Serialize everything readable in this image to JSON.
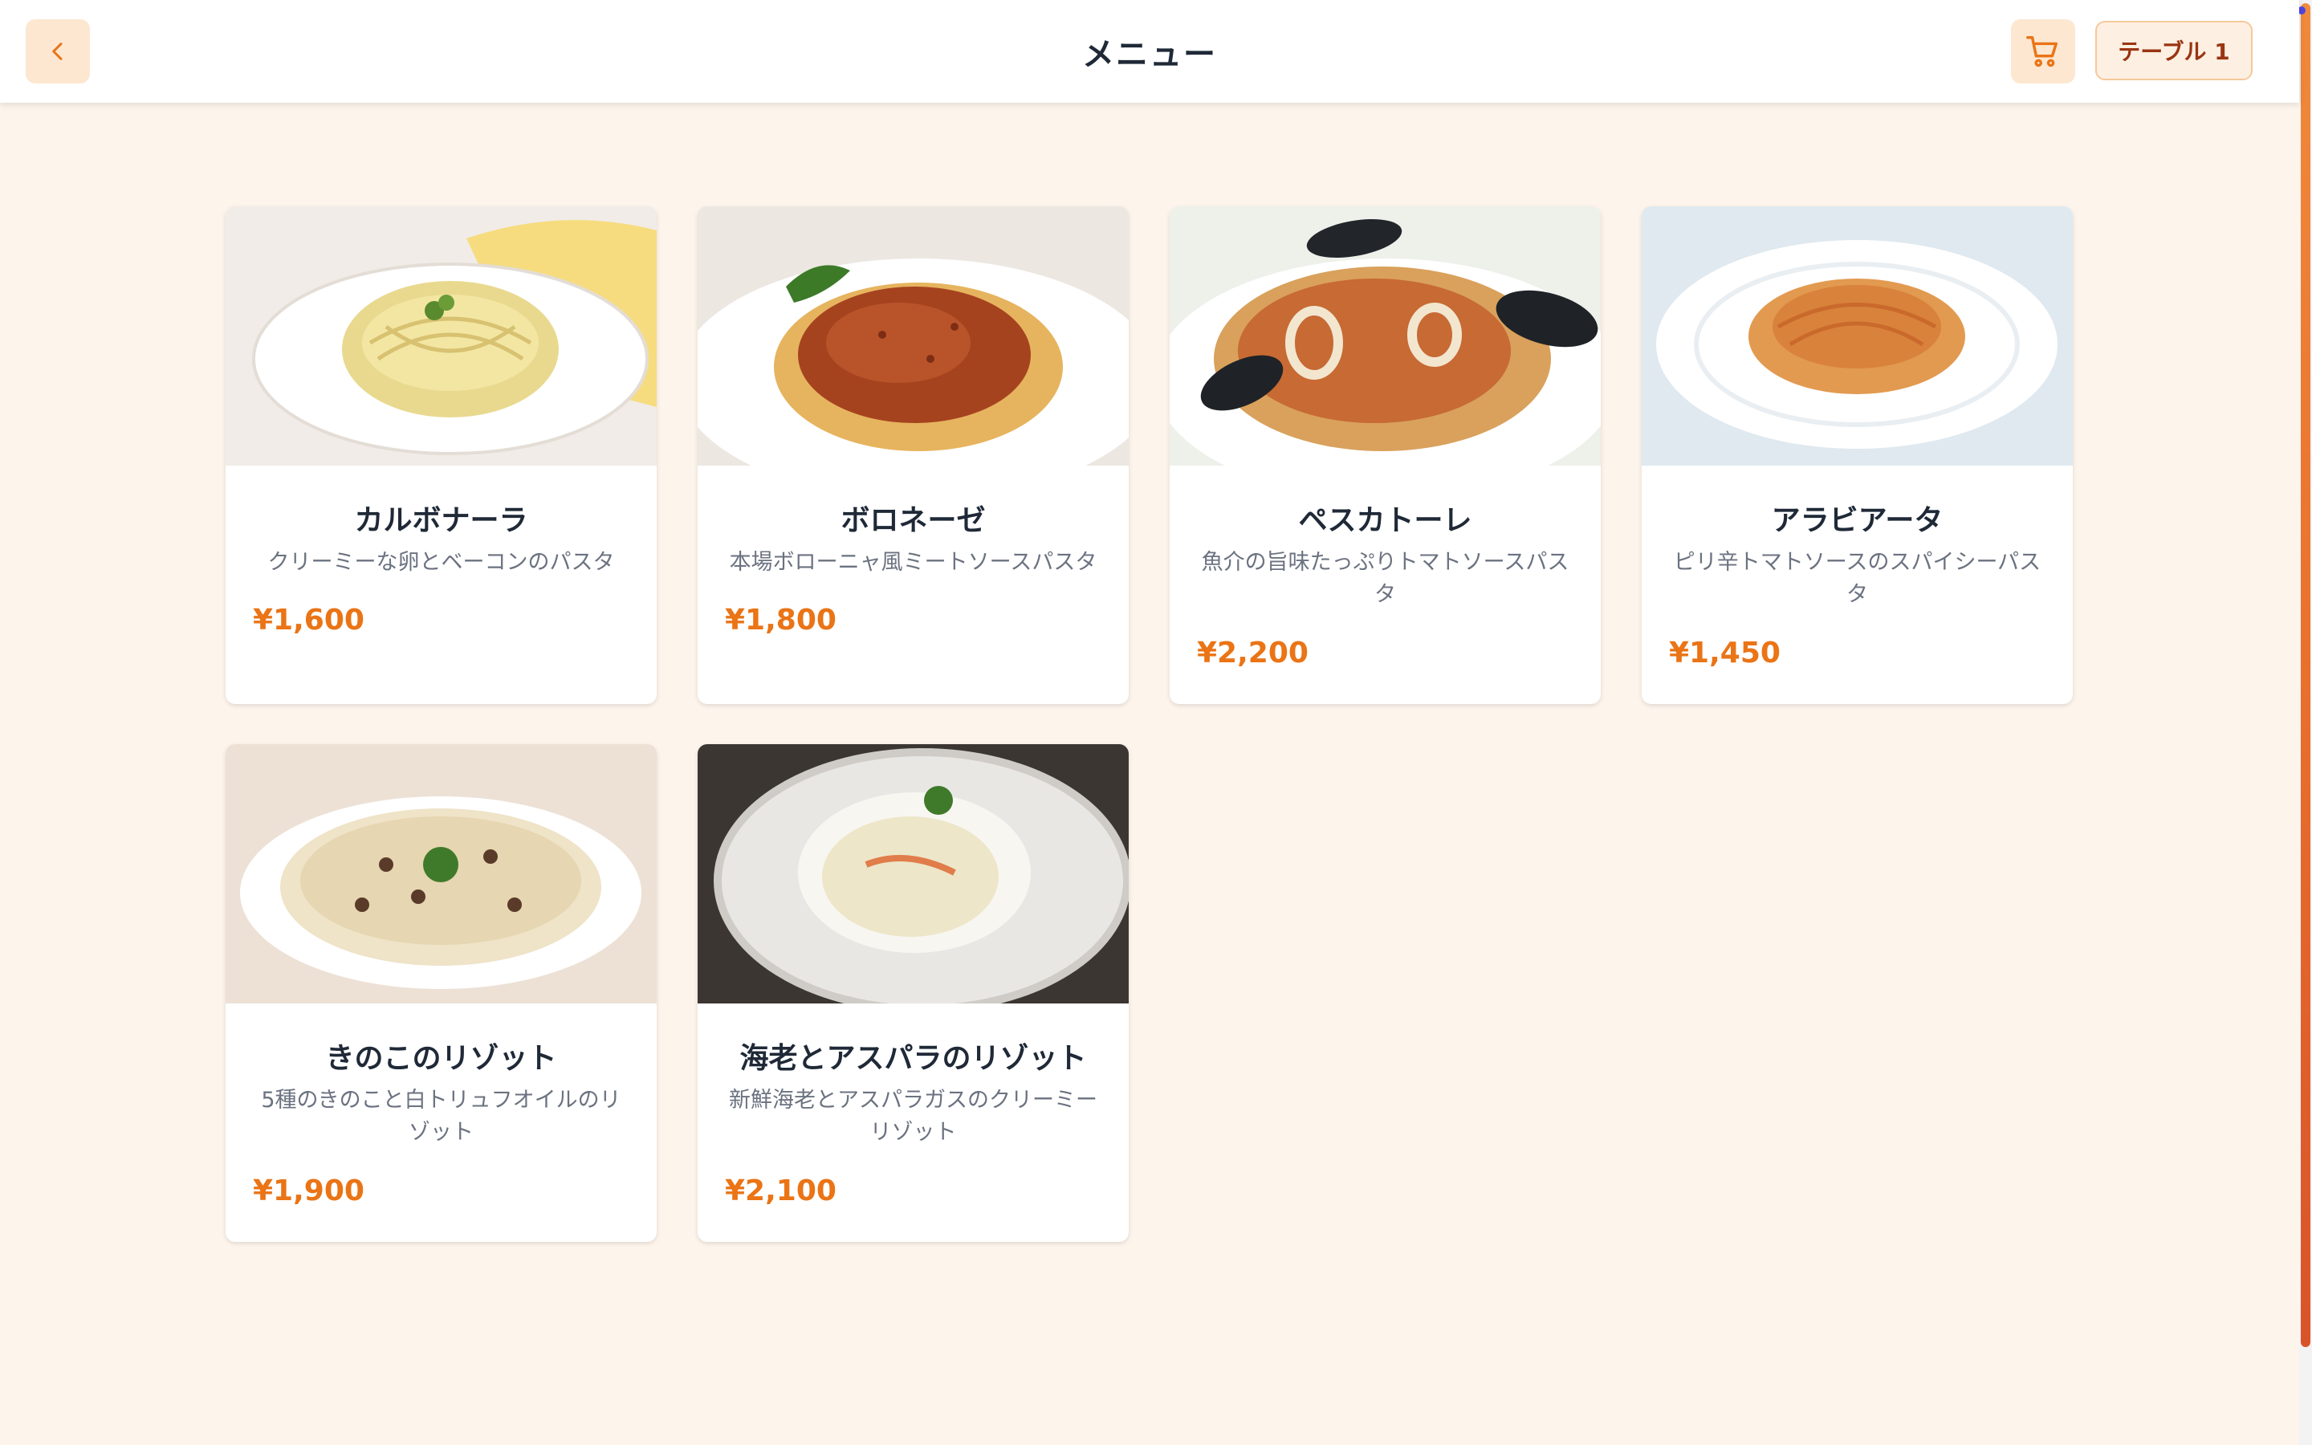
{
  "header": {
    "title": "メニュー",
    "table_label": "テーブル 1",
    "back_icon": "chevron-left-icon",
    "cart_icon": "cart-icon",
    "accent_color": "#ea7416"
  },
  "menu": {
    "items": [
      {
        "name": "カルボナーラ",
        "description": "クリーミーな卵とベーコンのパスタ",
        "price": "¥1,600"
      },
      {
        "name": "ボロネーゼ",
        "description": "本場ボローニャ風ミートソースパスタ",
        "price": "¥1,800"
      },
      {
        "name": "ペスカトーレ",
        "description": "魚介の旨味たっぷりトマトソースパスタ",
        "price": "¥2,200"
      },
      {
        "name": "アラビアータ",
        "description": "ピリ辛トマトソースのスパイシーパスタ",
        "price": "¥1,450"
      },
      {
        "name": "きのこのリゾット",
        "description": "5種のきのこと白トリュフオイルのリゾット",
        "price": "¥1,900"
      },
      {
        "name": "海老とアスパラのリゾット",
        "description": "新鮮海老とアスパラガスのクリーミーリゾット",
        "price": "¥2,100"
      }
    ]
  }
}
